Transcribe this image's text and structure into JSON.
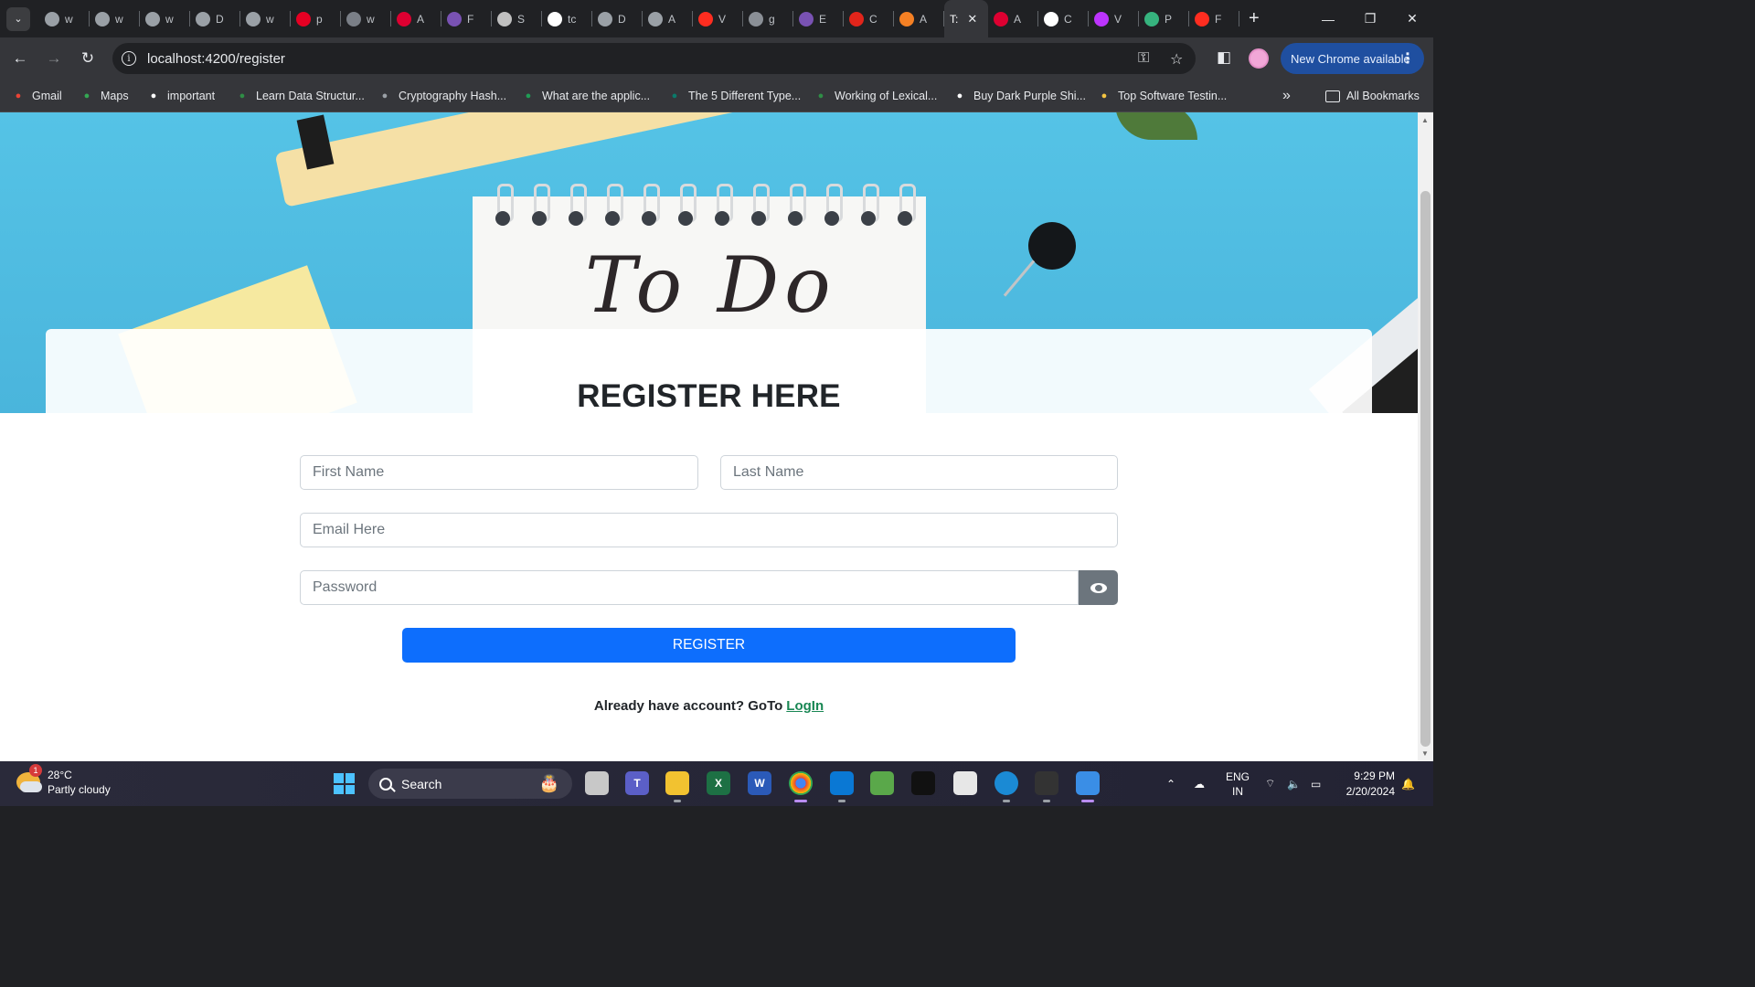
{
  "browser": {
    "tabs": [
      {
        "letter": "w",
        "icon": "globe-icon",
        "color": "#9aa0a6"
      },
      {
        "letter": "w",
        "icon": "globe-icon",
        "color": "#9aa0a6"
      },
      {
        "letter": "w",
        "icon": "globe-icon",
        "color": "#9aa0a6"
      },
      {
        "letter": "D",
        "icon": "globe-icon",
        "color": "#9aa0a6"
      },
      {
        "letter": "w",
        "icon": "globe-icon",
        "color": "#9aa0a6"
      },
      {
        "letter": "p",
        "icon": "pinterest-icon",
        "color": "#e60023"
      },
      {
        "letter": "w",
        "icon": "image-icon",
        "color": "#7a7f87"
      },
      {
        "letter": "A",
        "icon": "angular-icon",
        "color": "#dd0031"
      },
      {
        "letter": "F",
        "icon": "bootstrap-icon",
        "color": "#7952b3"
      },
      {
        "letter": "S",
        "icon": "donut-icon",
        "color": "#c0c0c0"
      },
      {
        "letter": "tc",
        "icon": "google-icon",
        "color": "#ffffff"
      },
      {
        "letter": "D",
        "icon": "globe-icon",
        "color": "#9aa0a6"
      },
      {
        "letter": "A",
        "icon": "globe-icon",
        "color": "#9aa0a6"
      },
      {
        "letter": "V",
        "icon": "laravel-icon",
        "color": "#ff2d20"
      },
      {
        "letter": "g",
        "icon": "b-icon",
        "color": "#8a8f96"
      },
      {
        "letter": "E",
        "icon": "bootstrap-icon",
        "color": "#7952b3"
      },
      {
        "letter": "C",
        "icon": "acrobat-icon",
        "color": "#e1251b"
      },
      {
        "letter": "A",
        "icon": "stackoverflow-icon",
        "color": "#f48024"
      },
      {
        "letter": "T:",
        "icon": "",
        "color": "",
        "active": true
      },
      {
        "letter": "A",
        "icon": "angular-icon",
        "color": "#dd0031"
      },
      {
        "letter": "C",
        "icon": "github-icon",
        "color": "#ffffff"
      },
      {
        "letter": "V",
        "icon": "vite-icon",
        "color": "#bd34fe"
      },
      {
        "letter": "P",
        "icon": "w-icon",
        "color": "#36b37e"
      },
      {
        "letter": "F",
        "icon": "laravel-icon",
        "color": "#ff2d20"
      }
    ],
    "url": "localhost:4200/register",
    "new_chrome_label": "New Chrome available",
    "bookmarks": [
      {
        "label": "Gmail",
        "icon": "gmail-icon",
        "color": "#ea4335"
      },
      {
        "label": "Maps",
        "icon": "maps-icon",
        "color": "#34a853"
      },
      {
        "label": "important",
        "icon": "google-icon",
        "color": "#ffffff"
      },
      {
        "label": "Learn Data Structur...",
        "icon": "gfg-icon",
        "color": "#2f8d46"
      },
      {
        "label": "Cryptography Hash...",
        "icon": "globe-icon",
        "color": "#9aa0a6"
      },
      {
        "label": "What are the applic...",
        "icon": "f-icon",
        "color": "#1f9d55"
      },
      {
        "label": "The 5 Different Type...",
        "icon": "t-icon",
        "color": "#0a7a6a"
      },
      {
        "label": "Working of Lexical...",
        "icon": "gfg-icon",
        "color": "#2f8d46"
      },
      {
        "label": "Buy Dark Purple Shi...",
        "icon": "a-icon",
        "color": "#ffffff"
      },
      {
        "label": "Top Software Testin...",
        "icon": "mountain-icon",
        "color": "#f5c542"
      }
    ],
    "all_bookmarks_label": "All Bookmarks"
  },
  "page": {
    "hero_text": "To Do",
    "title": "REGISTER HERE",
    "first_name_placeholder": "First Name",
    "last_name_placeholder": "Last Name",
    "email_placeholder": "Email Here",
    "password_placeholder": "Password",
    "register_label": "REGISTER",
    "already_text": "Already have account? GoTo",
    "login_link": "LogIn"
  },
  "taskbar": {
    "temperature": "28°C",
    "weather": "Partly cloudy",
    "weather_badge": "1",
    "search_label": "Search",
    "language": "ENG",
    "region": "IN",
    "time": "9:29 PM",
    "date": "2/20/2024"
  }
}
